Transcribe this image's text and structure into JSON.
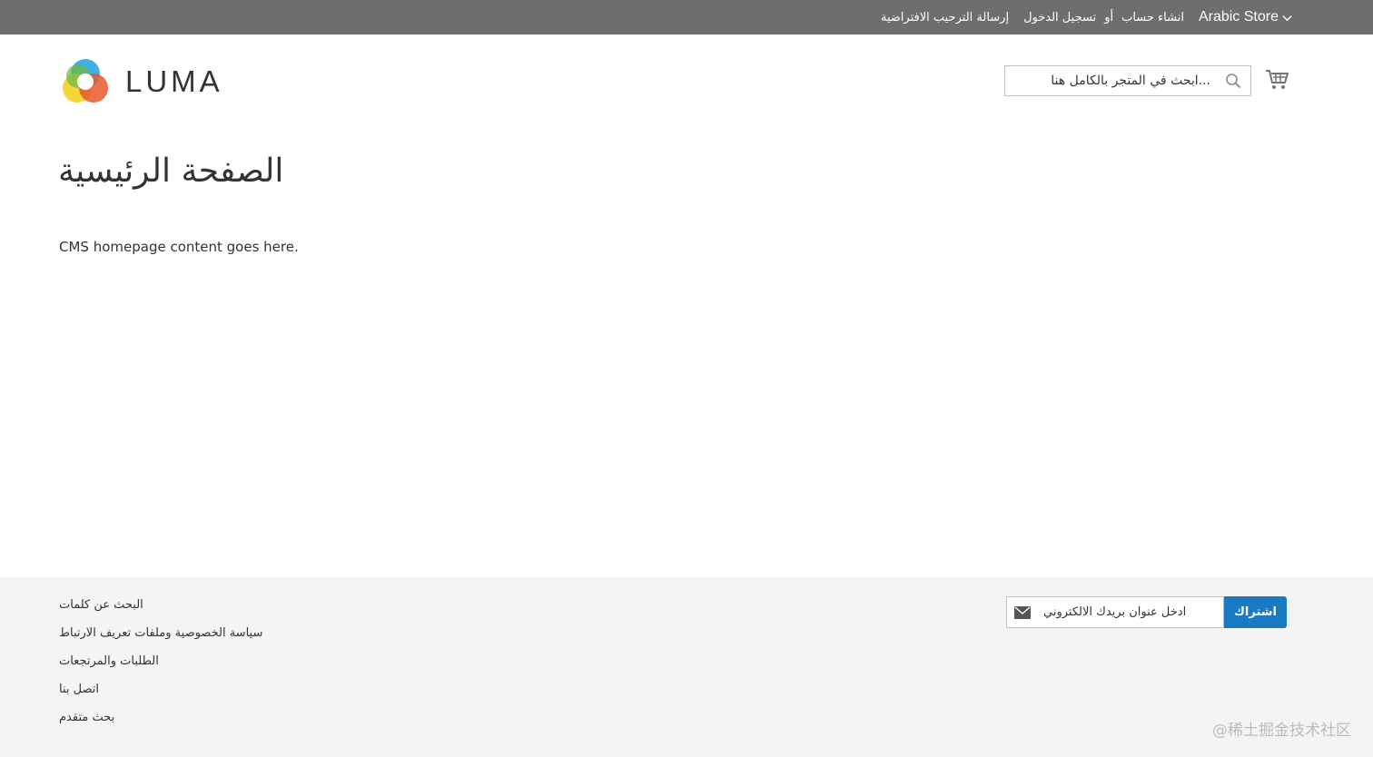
{
  "topbar": {
    "welcome": "إرسالة الترحيب الافتراضية",
    "sign_in": "تسجيل الدخول",
    "or": "أو",
    "create_account": "انشاء حساب",
    "store_switcher": "Arabic Store"
  },
  "header": {
    "logo_text": "LUMA",
    "search_placeholder": "...ابحث في المتجر بالكامل هنا"
  },
  "main": {
    "page_title": "الصفحة الرئيسية",
    "content": "CMS homepage content goes here."
  },
  "footer": {
    "links": [
      "البحث عن كلمات",
      "سياسة الخصوصية وملفات تعريف الارتباط",
      "الطلبات والمرتجعات",
      "اتصل بنا",
      "بحث متقدم"
    ],
    "newsletter": {
      "placeholder": "ادخل عنوان بريدك الالكتروني",
      "button": "اشتراك"
    },
    "watermark": "@稀土掘金技术社区"
  },
  "colors": {
    "topbar_bg": "#6e6e6e",
    "footer_bg": "#f4f4f4",
    "accent": "#1979c3"
  },
  "icons": [
    "chevron-down-icon",
    "search-icon",
    "cart-icon",
    "mail-icon",
    "luma-logo-icon"
  ]
}
